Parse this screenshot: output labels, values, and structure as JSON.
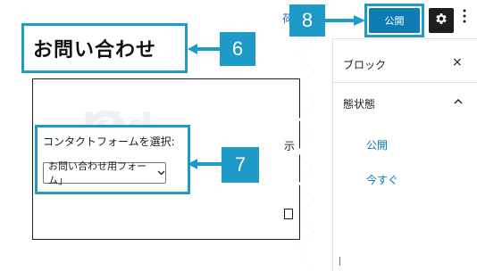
{
  "editor": {
    "page_title": "お問い合わせ",
    "watermark": "kid",
    "contact_form": {
      "label": "コンタクトフォームを選択:",
      "selected": "お問い合わせ用フォーム」"
    },
    "partial_texts": [
      "示"
    ]
  },
  "toolbar": {
    "partial_label": "荷",
    "publish_label": "公開",
    "settings_icon": "gear-icon",
    "options_icon": "vertical-ellipsis-icon"
  },
  "sidebar": {
    "tab_label": "ブロック",
    "close_glyph": "×",
    "status_label": "態状態",
    "caret_glyph": "^",
    "visibility_value": "公開",
    "publish_time_value": "今すぐ"
  },
  "callouts": {
    "c6": "6",
    "c7": "7",
    "c8": "8"
  },
  "colors": {
    "callout": "#1e9ac8",
    "publish_button": "#0f7bb3",
    "link": "#007cba",
    "settings_button": "#1e1e1e"
  }
}
